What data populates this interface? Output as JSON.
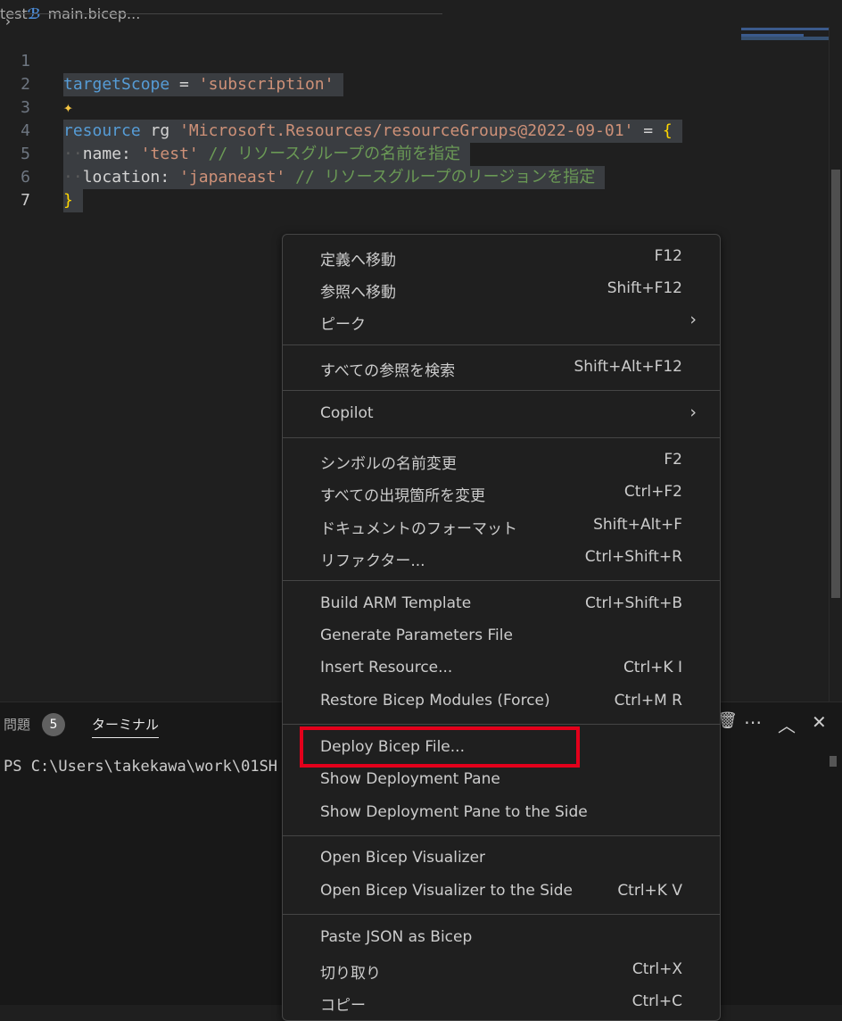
{
  "breadcrumb": {
    "folder": "test",
    "file": "main.bicep",
    "more": "..."
  },
  "editor": {
    "line_numbers": [
      "1",
      "2",
      "3",
      "4",
      "5",
      "6",
      "7"
    ],
    "line1": {
      "kw": "targetScope",
      "op": " = ",
      "str": "'subscription'"
    },
    "line3": {
      "kw": "resource",
      "name": " rg ",
      "str": "'Microsoft.Resources/resourceGroups@2022-09-01'",
      "op": " = ",
      "brace": "{"
    },
    "line4": {
      "prop": "name: ",
      "str": "'test'",
      "comment": " // リソースグループの名前を指定"
    },
    "line5": {
      "prop": "location: ",
      "str": "'japaneast'",
      "comment": " // リソースグループのリージョンを指定"
    },
    "line6": {
      "brace": "}"
    }
  },
  "panel": {
    "problems_label": "問題",
    "problems_count": "5",
    "terminal_label": "ターミナル",
    "terminal_line": "PS C:\\Users\\takekawa\\work\\01SH"
  },
  "context_menu": {
    "items": [
      {
        "label": "定義へ移動",
        "shortcut": "F12"
      },
      {
        "label": "参照へ移動",
        "shortcut": "Shift+F12"
      },
      {
        "label": "ピーク",
        "shortcut": ""
      },
      {
        "label": "すべての参照を検索",
        "shortcut": "Shift+Alt+F12"
      },
      {
        "label": "Copilot",
        "shortcut": ""
      },
      {
        "label": "シンボルの名前変更",
        "shortcut": "F2"
      },
      {
        "label": "すべての出現箇所を変更",
        "shortcut": "Ctrl+F2"
      },
      {
        "label": "ドキュメントのフォーマット",
        "shortcut": "Shift+Alt+F"
      },
      {
        "label": "リファクター...",
        "shortcut": "Ctrl+Shift+R"
      },
      {
        "label": "Build ARM Template",
        "shortcut": "Ctrl+Shift+B"
      },
      {
        "label": "Generate Parameters File",
        "shortcut": ""
      },
      {
        "label": "Insert Resource...",
        "shortcut": "Ctrl+K I"
      },
      {
        "label": "Restore Bicep Modules (Force)",
        "shortcut": "Ctrl+M R"
      },
      {
        "label": "Deploy Bicep File...",
        "shortcut": ""
      },
      {
        "label": "Show Deployment Pane",
        "shortcut": ""
      },
      {
        "label": "Show Deployment Pane to the Side",
        "shortcut": ""
      },
      {
        "label": "Open Bicep Visualizer",
        "shortcut": ""
      },
      {
        "label": "Open Bicep Visualizer to the Side",
        "shortcut": "Ctrl+K V"
      },
      {
        "label": "Paste JSON as Bicep",
        "shortcut": ""
      },
      {
        "label": "切り取り",
        "shortcut": "Ctrl+X"
      },
      {
        "label": "コピー",
        "shortcut": "Ctrl+C"
      }
    ]
  },
  "icons": {
    "chevron": "chevron-right-icon",
    "bicep": "bicep-file-icon",
    "sparkle": "sparkle-icon"
  },
  "colors": {
    "highlight_box": "#e3001b",
    "editor_bg": "#1f1f1f",
    "selection_bg": "#3a3d41"
  }
}
